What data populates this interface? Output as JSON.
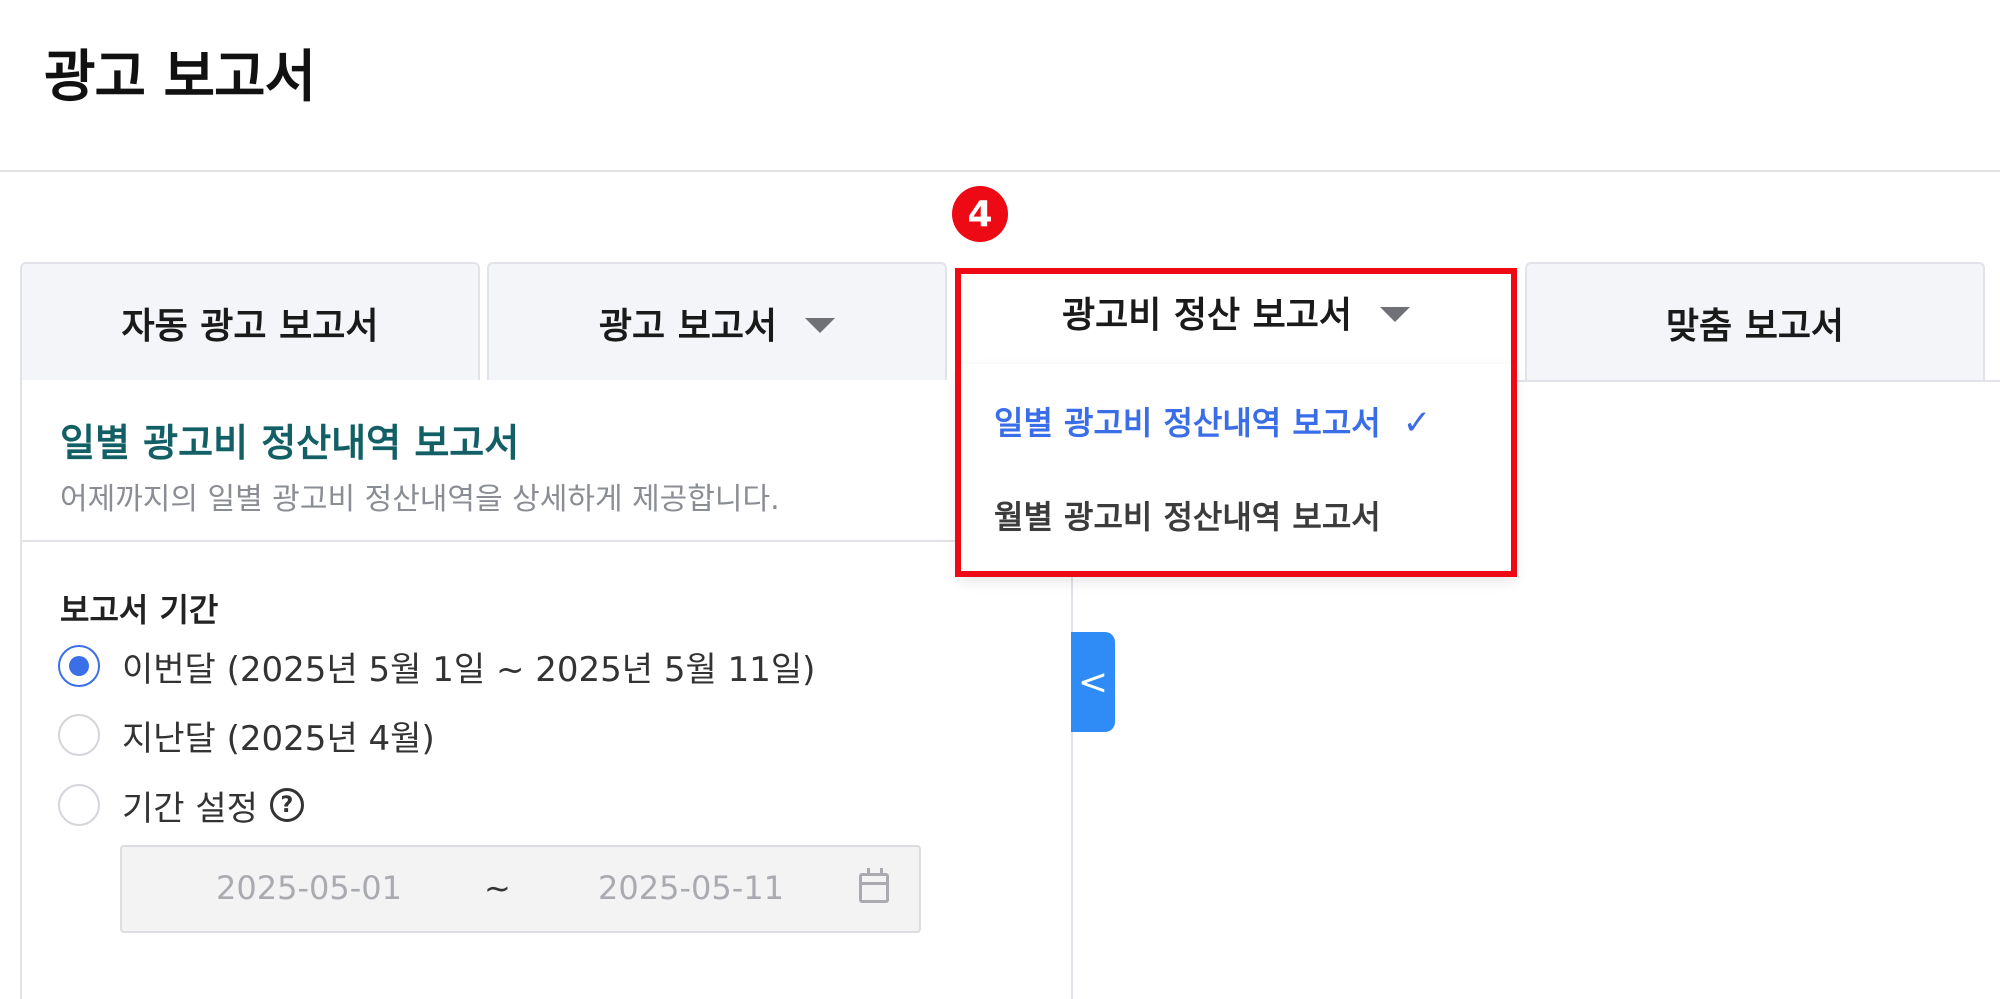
{
  "page": {
    "title": "광고 보고서"
  },
  "tabs": [
    {
      "label": "자동 광고 보고서"
    },
    {
      "label": "광고 보고서"
    },
    {
      "label": "광고비 정산 보고서"
    },
    {
      "label": "맞춤 보고서"
    }
  ],
  "active_tab_index": 2,
  "dropdown": {
    "items": [
      {
        "label": "일별 광고비 정산내역 보고서",
        "selected": true
      },
      {
        "label": "월별 광고비 정산내역 보고서",
        "selected": false
      }
    ],
    "check_icon": "✓"
  },
  "annotation": {
    "step_number": "4",
    "color": "#ee0a14"
  },
  "report": {
    "title": "일별 광고비 정산내역 보고서",
    "description": "어제까지의 일별 광고비 정산내역을 상세하게 제공합니다."
  },
  "period": {
    "label": "보고서 기간",
    "options": [
      {
        "label": "이번달 (2025년 5월 1일 ~ 2025년 5월 11일)",
        "checked": true
      },
      {
        "label": "지난달 (2025년 4월)",
        "checked": false
      },
      {
        "label": "기간 설정",
        "checked": false
      }
    ],
    "help_icon": "?",
    "range": {
      "start": "2025-05-01",
      "separator": "~",
      "end": "2025-05-11"
    }
  },
  "collapse_icon": "<",
  "colors": {
    "accent": "#2f6af0",
    "title_teal": "#126066",
    "radio": "#3a6fe8"
  }
}
